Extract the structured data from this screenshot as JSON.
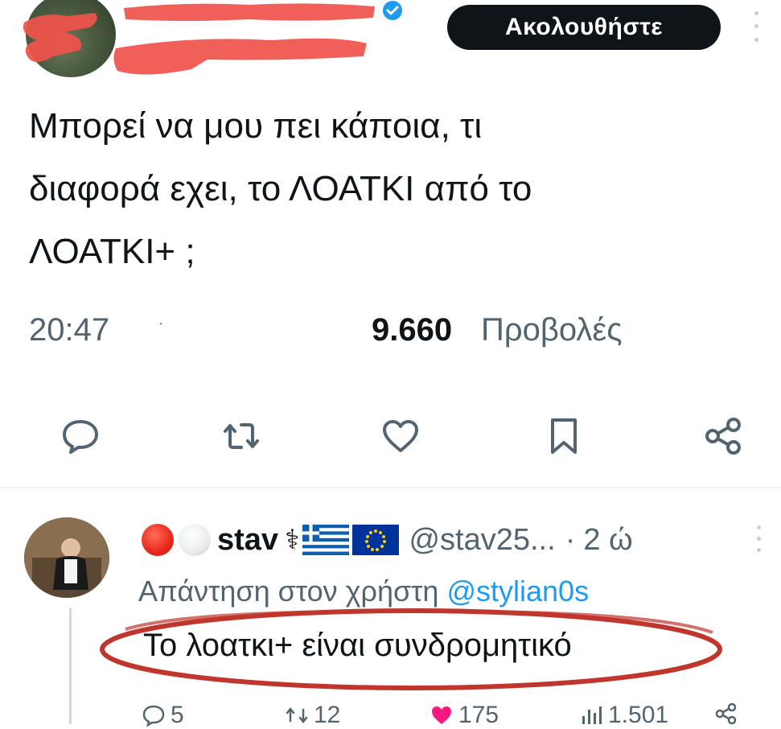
{
  "tweet": {
    "follow_label": "Ακολουθήστε",
    "text_lines": [
      "Μπορεί να μου πει κάποια, τι",
      "διαφορά εχει, το ΛΟΑΤΚΙ από το",
      "ΛΟΑΤΚΙ+ ;"
    ],
    "time": "20:47",
    "separator": "·",
    "views_count": "9.660",
    "views_label": "Προβολές",
    "icons": [
      "reply-icon",
      "retweet-icon",
      "like-icon",
      "bookmark-icon",
      "share-icon"
    ]
  },
  "reply": {
    "display_name": "stav",
    "name_symbol": "⚕",
    "handle": "@stav25...",
    "separator": "·",
    "time": "2 ώ",
    "context_prefix": "Απάντηση στον χρήστη",
    "context_mention": "@stylian0s",
    "text": "Το λοατκι+ είναι συνδρομητικό",
    "stats": {
      "replies": "5",
      "retweets": "12",
      "likes": "175",
      "views": "1.501"
    }
  },
  "colors": {
    "text_primary": "#0f1419",
    "text_secondary": "#536471",
    "link": "#1d9bf0",
    "follow_bg": "#0f1419",
    "verified": "#1d9bf0",
    "redaction": "#f0524a",
    "circle_mark": "#c0362c",
    "like": "#f91880"
  }
}
